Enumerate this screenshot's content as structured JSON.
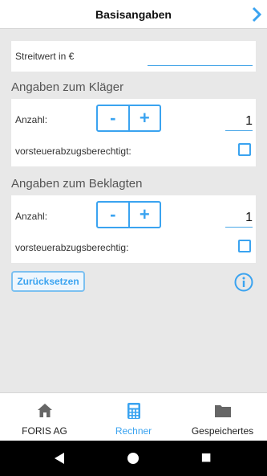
{
  "header": {
    "title": "Basisangaben",
    "next_icon": "chevron-right-icon"
  },
  "streitwert": {
    "label": "Streitwert in €",
    "value": ""
  },
  "klaeger": {
    "section_title": "Angaben zum Kläger",
    "count_label": "Anzahl:",
    "minus_label": "-",
    "plus_label": "+",
    "count_value": "1",
    "vat_label": "vorsteuerabzugsberechtigt:",
    "vat_checked": false
  },
  "beklagte": {
    "section_title": "Angaben zum Beklagten",
    "count_label": "Anzahl:",
    "minus_label": "-",
    "plus_label": "+",
    "count_value": "1",
    "vat_label": "vorsteuerabzugsberechtig:",
    "vat_checked": false
  },
  "actions": {
    "reset_label": "Zurücksetzen",
    "info_icon": "info-icon"
  },
  "tabs": [
    {
      "label": "FORIS AG",
      "icon": "home-icon",
      "active": false
    },
    {
      "label": "Rechner",
      "icon": "calculator-icon",
      "active": true
    },
    {
      "label": "Gespeichertes",
      "icon": "folder-icon",
      "active": false
    }
  ],
  "system_nav": {
    "back_icon": "back-triangle-icon",
    "home_icon": "home-circle-icon",
    "recents_icon": "recents-square-icon"
  },
  "colors": {
    "accent": "#3aa3f0",
    "background": "#e8e8e8",
    "card": "#ffffff"
  }
}
